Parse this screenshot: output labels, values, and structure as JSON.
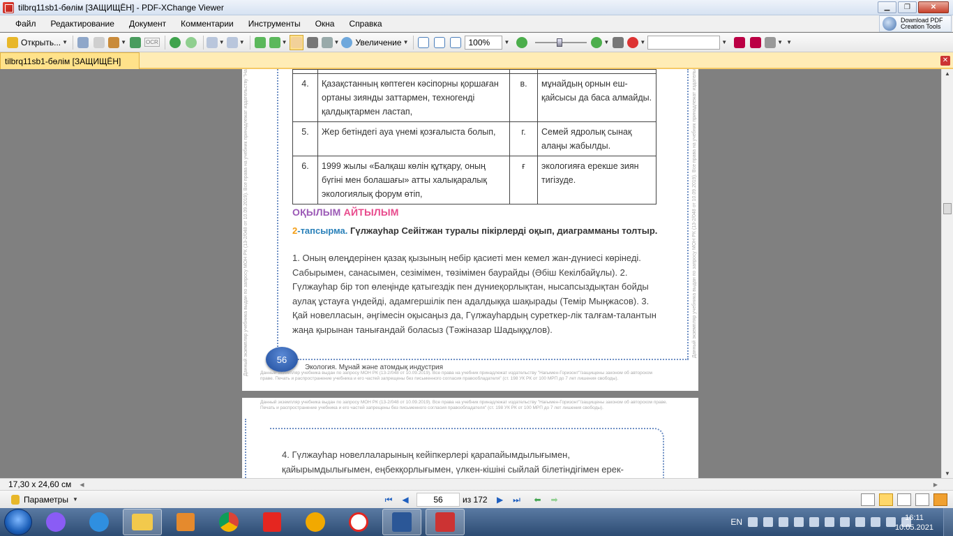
{
  "window": {
    "title": "tilbrq11sb1-бөлім [ЗАЩИЩЁН] - PDF-XChange Viewer",
    "minimize": "▁",
    "maximize": "❐",
    "close": "✕"
  },
  "menu": {
    "items": [
      "Файл",
      "Редактирование",
      "Документ",
      "Комментарии",
      "Инструменты",
      "Окна",
      "Справка"
    ],
    "download_pdf": "Download PDF Creation Tools"
  },
  "toolbar": {
    "open_label": "Открыть...",
    "ocr": "OCR",
    "zoom_label": "Увеличение",
    "zoom_value": "100%",
    "zoom_slider_level": 0.5,
    "search_placeholder": ""
  },
  "tab": {
    "title": "tilbrq11sb1-бөлім [ЗАЩИЩЁН]",
    "close": "✕"
  },
  "page1": {
    "side_left": "Данный экземпляр учебника выдан по запросу МОН РК (13-2/048 от 10.09.2019). Все права на учебник принадлежат издательству \"Нағымен-Горизонт\"/защищены законом об авторском праве.",
    "side_right": "Данный экземпляр учебника выдан по запросу МОН РК (13-2/048 от 10.09.2019). Все права на учебник принадлежат издательству",
    "table": [
      {
        "num": "4.",
        "text": "Қазақстанның көптеген кәсіпорны қоршаған ортаны зиянды заттармен, техногенді қалдықтармен ластап,",
        "letter": "в.",
        "answer": "мұнайдың орнын еш-қайсысы да баса алмайды."
      },
      {
        "num": "5.",
        "text": "Жер бетіндегі ауа үнемі қозғалыста болып,",
        "letter": "г.",
        "answer": "Семей ядролық сынақ алаңы жабылды."
      },
      {
        "num": "6.",
        "text": "1999 жылы «Балқаш көлін құтқару, оның бүгіні мен болашағы» атты халықаралық экологиялық форум өтіп,",
        "letter": "ғ",
        "answer": "экологияға ерекше зиян тигізуде."
      }
    ],
    "heading_part1": "ОҚЫЛЫМ",
    "heading_part2": "АЙТЫЛЫМ",
    "task_number": "2",
    "task_label": "-тапсырма.",
    "task_text": "Гүлжауһар Сейітжан туралы пікірлерді оқып, диаграмманы толтыр.",
    "body": "1.      Оның өлеңдерінен қазақ қызының небір қасиеті мен кемел жан-дүниесі көрінеді. Сабырымен, санасымен, сезімімен, төзімімен баурайды (Әбіш Кекілбайұлы). 2. Гүлжауһар бір топ өлеңінде қатыгездік пен дүниеқорлықтан, нысапсыздықтан бойды аулақ ұстауға үндейді, адамгершілік пен адалдыққа шақырады (Темір Мыңжасов). 3. Қай новелласын, әңгімесін оқысаңыз да, Гүлжауһардың суреткер-лік талғам-талантын жаңа қырынан танығандай боласыз (Тәжіназар Шадыққұлов).",
    "page_number": "56",
    "footer_title": "Экология. Мұнай және атомдық индустрия",
    "footer_small": "Данный экземпляр учебника выдан по запросу МОН РК (13-2/048 от 10.09.2019). Все права на учебник принадлежат издательству \"Нағымен-Горизонт\"/защищены законом об авторском праве. Печать и распространение учебника и его частей запрещены без письменного согласия правообладателя\" (ст. 198 УК РК от 100 МРП до 7 лет лишения свободы)."
  },
  "page2": {
    "head_small": "Данный экземпляр учебника выдан по запросу МОН РК (13-2/048 от 10.09.2019). Все права на учебник принадлежат издательству \"Нағымен-Горизонт\"/защищены законом об авторском праве. Печать и распространение учебника и его частей запрещены без письменного согласия правообладателя\" (ст. 198 УК РК от 100 МРП до 7 лет лишения свободы).",
    "text": "4. Гүлжауһар новеллаларының кейіпкерлері қарапайымдылығымен, қайырымдылығымен, еңбекқорлығымен, үлкен-кішіні сыйлай білетіндігімен ерек-"
  },
  "status": {
    "page_size": "17,30 x 24,60 см",
    "params_label": "Параметры",
    "current_page": "56",
    "page_total": "из 172"
  },
  "taskbar": {
    "lang": "EN",
    "time": "16:11",
    "date": "10.05.2021"
  }
}
